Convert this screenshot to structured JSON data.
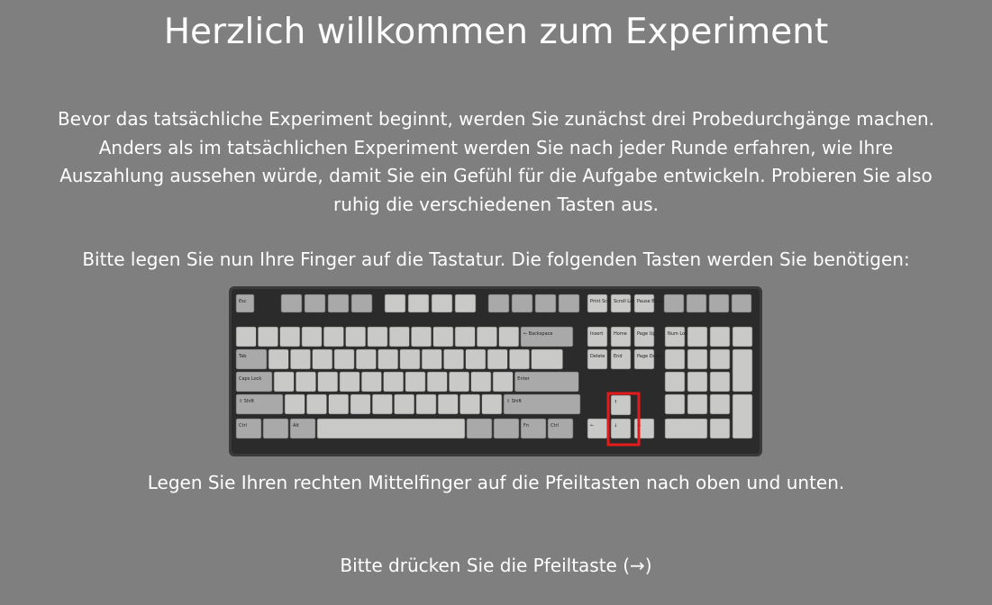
{
  "title": "Herzlich willkommen zum Experiment",
  "intro_lines": [
    "Bevor das tatsächliche Experiment beginnt, werden Sie zunächst drei Probedurchgänge machen.",
    "Anders als im tatsächlichen Experiment werden Sie nach jeder Runde erfahren, wie Ihre",
    "Auszahlung aussehen würde, damit Sie ein Gefühl für die Aufgabe entwickeln. Probieren Sie also",
    "ruhig die verschiedenen Tasten aus."
  ],
  "keys_instruction": "Bitte legen Sie nun Ihre Finger auf die Tastatur. Die folgenden Tasten werden Sie benötigen:",
  "finger_hint": "Legen Sie Ihren rechten Mittelfinger auf die Pfeiltasten nach oben und unten.",
  "continue_prompt": "Bitte drücken Sie die Pfeiltaste (→)",
  "keyboard": {
    "highlight_color": "#e31b1b",
    "highlighted_keys": [
      "↑",
      "↓"
    ],
    "key_labels": {
      "esc": "Esc",
      "backspace": "← Backspace",
      "tab": "Tab",
      "caps": "Caps Lock",
      "enter": "Enter",
      "shift_l": "⇧ Shift",
      "shift_r": "⇧ Shift",
      "ctrl_l": "Ctrl",
      "ctrl_r": "Ctrl",
      "alt": "Alt",
      "fn": "Fn",
      "insert": "Insert",
      "home": "Home",
      "pgup": "Page Up",
      "delete": "Delete",
      "end": "End",
      "pgdn": "Page Down",
      "prtsc": "Print Screen",
      "scroll": "Scroll Lock",
      "pause": "Pause Break",
      "numlock": "Num Lock",
      "up": "↑",
      "down": "↓",
      "left": "←",
      "right": "→"
    }
  }
}
